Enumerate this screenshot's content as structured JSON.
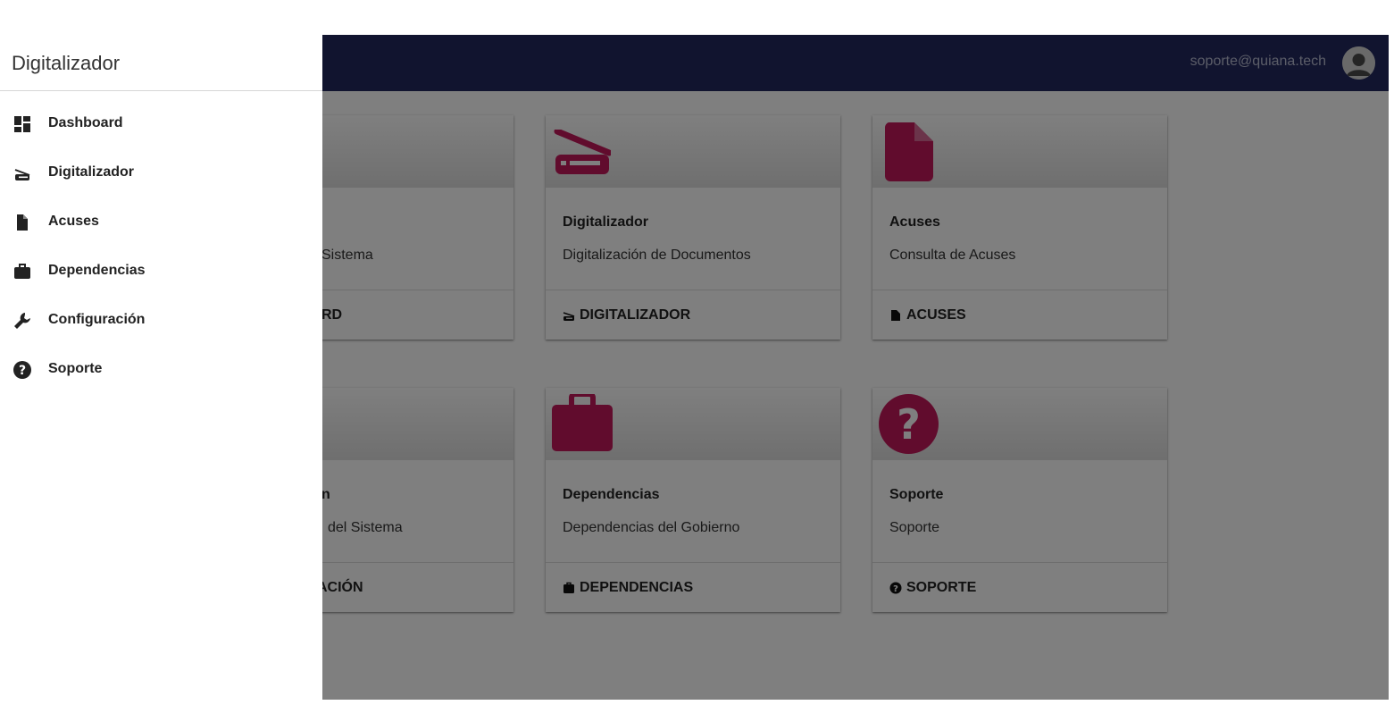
{
  "drawer": {
    "title": "Digitalizador",
    "items": [
      {
        "label": "Dashboard",
        "icon": "dashboard-icon"
      },
      {
        "label": "Digitalizador",
        "icon": "scanner-icon"
      },
      {
        "label": "Acuses",
        "icon": "file-icon"
      },
      {
        "label": "Dependencias",
        "icon": "briefcase-icon"
      },
      {
        "label": "Configuración",
        "icon": "wrench-icon"
      },
      {
        "label": "Soporte",
        "icon": "question-circle-icon"
      }
    ]
  },
  "toolbar": {
    "user_email": "soporte@quiana.tech",
    "avatar_icon": "user-avatar-icon"
  },
  "cards": [
    {
      "title": "",
      "subtitle": "Sistema",
      "action": "RD",
      "icon": "dashboard-icon"
    },
    {
      "title": "Digitalizador",
      "subtitle": "Digitalización de Documentos",
      "action": "DIGITALIZADOR",
      "icon": "scanner-icon"
    },
    {
      "title": "Acuses",
      "subtitle": "Consulta de Acuses",
      "action": "ACUSES",
      "icon": "file-icon"
    },
    {
      "title": "n",
      "subtitle": "del Sistema",
      "action": "ACIÓN",
      "icon": "wrench-icon"
    },
    {
      "title": "Dependencias",
      "subtitle": "Dependencias del Gobierno",
      "action": "DEPENDENCIAS",
      "icon": "briefcase-icon"
    },
    {
      "title": "Soporte",
      "subtitle": "Soporte",
      "action": "SOPORTE",
      "icon": "question-circle-icon"
    }
  ],
  "colors": {
    "toolbar": "#22295f",
    "accent": "#c2185b",
    "drawer_bg": "#ffffff",
    "scrim": "rgba(0,0,0,0.5)"
  }
}
